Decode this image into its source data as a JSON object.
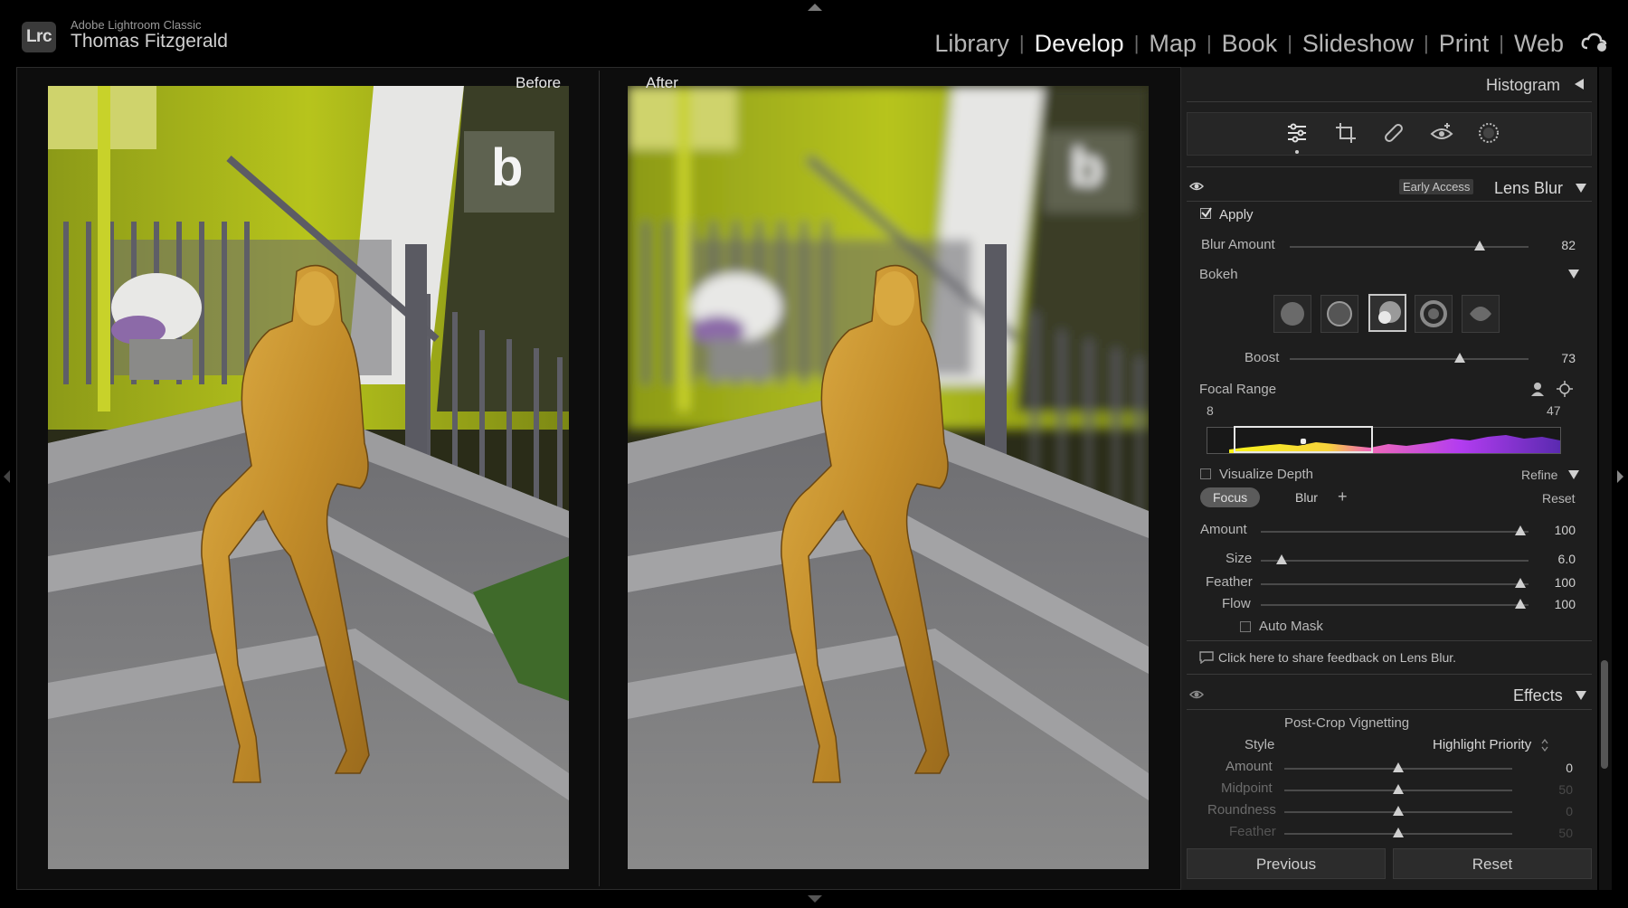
{
  "app": {
    "name": "Adobe Lightroom Classic",
    "logo_text": "Lrc",
    "user": "Thomas Fitzgerald"
  },
  "modules": [
    "Library",
    "Develop",
    "Map",
    "Book",
    "Slideshow",
    "Print",
    "Web"
  ],
  "active_module": "Develop",
  "view": {
    "before_label": "Before",
    "after_label": "After"
  },
  "panel": {
    "histogram_title": "Histogram",
    "tools": [
      "edit-sliders-icon",
      "crop-icon",
      "healing-icon",
      "red-eye-icon",
      "masking-icon"
    ],
    "lens_blur": {
      "badge": "Early Access",
      "title": "Lens Blur",
      "apply_label": "Apply",
      "apply_checked": true,
      "blur_amount_label": "Blur Amount",
      "blur_amount": 82,
      "bokeh_label": "Bokeh",
      "bokeh_selected": 3,
      "boost_label": "Boost",
      "boost": 73,
      "focal_range_label": "Focal Range",
      "focal_min": "8",
      "focal_max": "47",
      "visualize_label": "Visualize Depth",
      "refine_label": "Refine",
      "focus_label": "Focus",
      "blur_label": "Blur",
      "plus_label": "+",
      "reset_label": "Reset",
      "brush": {
        "amount_label": "Amount",
        "amount": "100",
        "size_label": "Size",
        "size": "6.0",
        "feather_label": "Feather",
        "feather": "100",
        "flow_label": "Flow",
        "flow": "100"
      },
      "auto_mask_label": "Auto Mask",
      "feedback": "Click here to share feedback on Lens Blur."
    },
    "effects": {
      "title": "Effects",
      "vignette_title": "Post-Crop Vignetting",
      "style_label": "Style",
      "style_value": "Highlight Priority",
      "amount_label": "Amount",
      "amount": "0",
      "midpoint_label": "Midpoint",
      "midpoint": "50",
      "roundness_label": "Roundness",
      "roundness": "0",
      "feather_label": "Feather",
      "feather": "50"
    },
    "previous_label": "Previous",
    "reset_label": "Reset"
  },
  "colors": {
    "accent": "#e5e5e5",
    "panel_bg": "#1e1e1e",
    "sculpture": "#c9962e",
    "facade": "#b6c31d"
  }
}
